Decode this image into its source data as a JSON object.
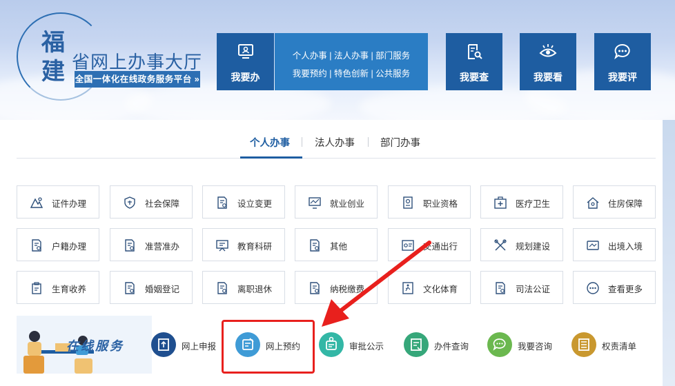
{
  "logo": {
    "char_fu": "福",
    "char_jian": "建",
    "title": "省网上办事大厅",
    "subtitle": "全国一体化在线政务服务平台 »"
  },
  "nav": {
    "handle": "我要办",
    "links_row1": "个人办事 | 法人办事 | 部门服务",
    "links_row2": "我要预约 | 特色创新 | 公共服务",
    "query": "我要查",
    "watch": "我要看",
    "review": "我要评"
  },
  "tabs": [
    "个人办事",
    "法人办事",
    "部门办事"
  ],
  "grid": [
    [
      {
        "label": "证件办理",
        "icon": "id-card-icon"
      },
      {
        "label": "社会保障",
        "icon": "shield-icon"
      },
      {
        "label": "设立变更",
        "icon": "document-icon"
      },
      {
        "label": "就业创业",
        "icon": "monitor-icon"
      },
      {
        "label": "职业资格",
        "icon": "certificate-icon"
      },
      {
        "label": "医疗卫生",
        "icon": "medical-kit-icon"
      },
      {
        "label": "住房保障",
        "icon": "house-icon"
      }
    ],
    [
      {
        "label": "户籍办理",
        "icon": "document-icon"
      },
      {
        "label": "准营准办",
        "icon": "document-icon"
      },
      {
        "label": "教育科研",
        "icon": "board-icon"
      },
      {
        "label": "其他",
        "icon": "document-icon"
      },
      {
        "label": "交通出行",
        "icon": "traffic-icon"
      },
      {
        "label": "规划建设",
        "icon": "tools-icon"
      },
      {
        "label": "出境入境",
        "icon": "passport-icon"
      }
    ],
    [
      {
        "label": "生育收养",
        "icon": "clipboard-icon"
      },
      {
        "label": "婚姻登记",
        "icon": "document-icon"
      },
      {
        "label": "离职退休",
        "icon": "document-icon"
      },
      {
        "label": "纳税缴费",
        "icon": "document-icon"
      },
      {
        "label": "文化体育",
        "icon": "runner-icon"
      },
      {
        "label": "司法公证",
        "icon": "document-icon"
      },
      {
        "label": "查看更多",
        "icon": "more-icon"
      }
    ]
  ],
  "services": {
    "title": "在线服务",
    "items": [
      {
        "label": "网上申报",
        "color": "#1f4f8f"
      },
      {
        "label": "网上预约",
        "color": "#3f9bd6"
      },
      {
        "label": "审批公示",
        "color": "#33b7a6"
      },
      {
        "label": "办件查询",
        "color": "#36a77a"
      },
      {
        "label": "我要咨询",
        "color": "#6bb84f"
      },
      {
        "label": "权责清单",
        "color": "#c9982f"
      }
    ]
  },
  "colors": {
    "nav_dark": "#1e5da1",
    "nav_light": "#2b7dc4",
    "highlight": "#e8201d"
  }
}
